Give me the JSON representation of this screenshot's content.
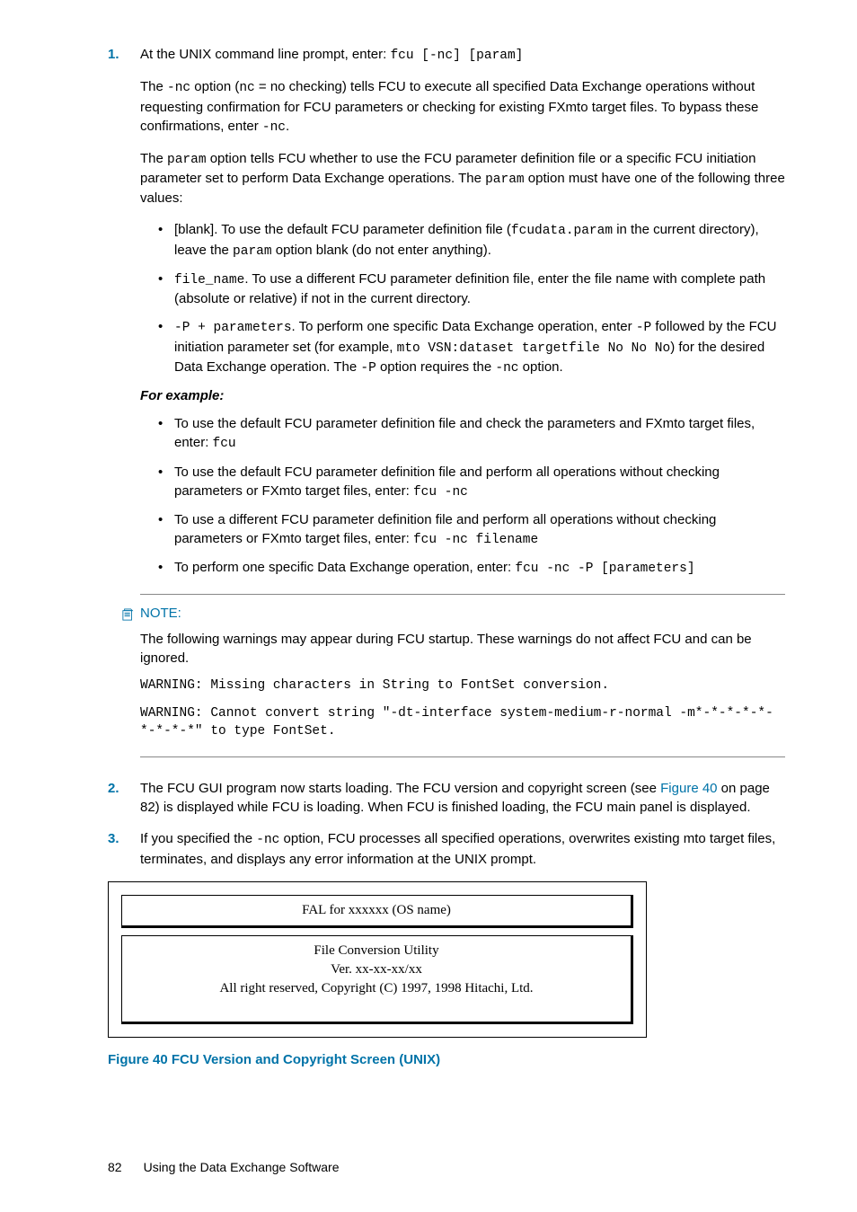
{
  "step1": {
    "num": "1.",
    "intro_a": "At the UNIX command line prompt, enter: ",
    "intro_cmd": "fcu [-nc] [param]",
    "para2_a": "The ",
    "para2_b": "-nc",
    "para2_c": " option (",
    "para2_d": "nc",
    "para2_e": " = no checking) tells FCU to execute all specified Data Exchange operations without requesting confirmation for FCU parameters or checking for existing FXmto target files. To bypass these confirmations, enter ",
    "para2_f": "-nc",
    "para2_g": ".",
    "para3_a": "The ",
    "para3_b": "param",
    "para3_c": " option tells FCU whether to use the FCU parameter definition file or a specific FCU initiation parameter set to perform Data Exchange operations. The ",
    "para3_d": "param",
    "para3_e": " option must have one of the following three values:",
    "b1_a": "[blank]. To use the default FCU parameter definition file (",
    "b1_b": "fcudata.param",
    "b1_c": " in the current directory), leave the ",
    "b1_d": "param",
    "b1_e": " option blank (do not enter anything).",
    "b2_a": "file_name",
    "b2_b": ". To use a different FCU parameter definition file, enter the file name with complete path (absolute or relative) if not in the current directory.",
    "b3_a": "-P + parameters",
    "b3_b": ". To perform one specific Data Exchange operation, enter ",
    "b3_c": "-P",
    "b3_d": " followed by the FCU initiation parameter set (for example, ",
    "b3_e": "mto VSN:dataset targetfile No No No",
    "b3_f": ") for the desired Data Exchange operation. The ",
    "b3_g": "-P",
    "b3_h": " option requires the ",
    "b3_i": "-nc",
    "b3_j": " option.",
    "example_label": "For example:",
    "ex1_a": "To use the default FCU parameter definition file and check the parameters and FXmto target files, enter: ",
    "ex1_b": "fcu",
    "ex2_a": "To use the default FCU parameter definition file and perform all operations without checking parameters or FXmto target files, enter: ",
    "ex2_b": "fcu -nc",
    "ex3_a": "To use a different FCU parameter definition file and perform all operations without checking parameters or FXmto target files, enter: ",
    "ex3_b": "fcu -nc filename",
    "ex4_a": "To perform one specific Data Exchange operation, enter: ",
    "ex4_b": "fcu -nc -P [parameters]"
  },
  "note": {
    "label": "NOTE:",
    "p1": "The following warnings may appear during FCU startup. These warnings do not affect FCU and can be ignored.",
    "w1": "WARNING: Missing characters in String to FontSet conversion.",
    "w2": "WARNING: Cannot convert string \"-dt-interface system-medium-r-normal -m*-*-*-*-*-*-*-*-*\" to type FontSet."
  },
  "step2": {
    "num": "2.",
    "a": "The FCU GUI program now starts loading. The FCU version and copyright screen (see ",
    "link": "Figure 40",
    "b": " on page 82) is displayed while FCU is loading. When FCU is finished loading, the FCU main panel is displayed."
  },
  "step3": {
    "num": "3.",
    "a": "If you specified the ",
    "b": "-nc",
    "c": " option, FCU processes all specified operations, overwrites existing mto target files, terminates, and displays any error information at the UNIX prompt."
  },
  "figure": {
    "title1": "FAL for xxxxxx (OS name)",
    "title2a": "File Conversion Utility",
    "title2b": "Ver. xx-xx-xx/xx",
    "title2c": "All right reserved, Copyright (C) 1997, 1998 Hitachi, Ltd.",
    "caption": "Figure 40 FCU Version and Copyright Screen (UNIX)"
  },
  "footer": {
    "page": "82",
    "chapter": "Using the Data Exchange Software"
  }
}
